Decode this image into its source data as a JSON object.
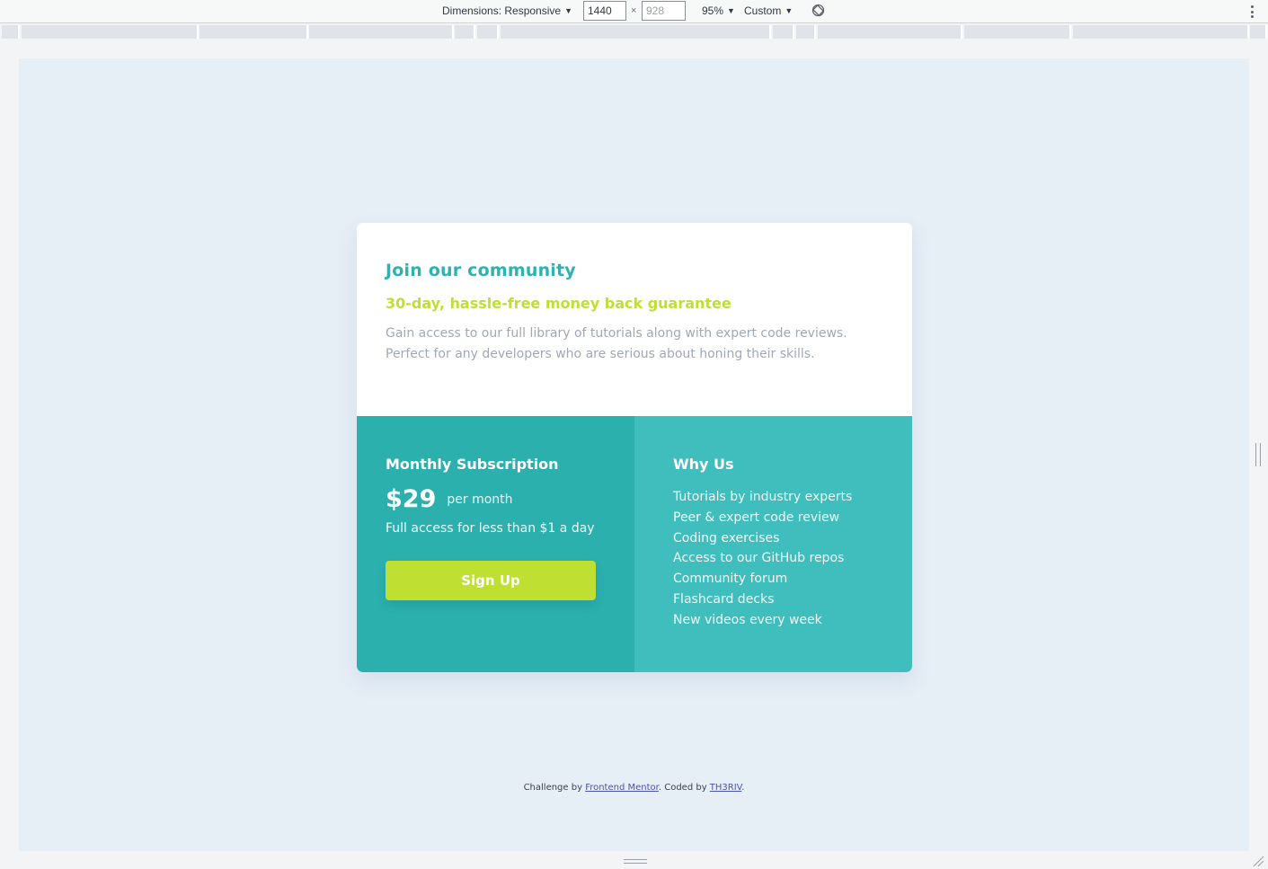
{
  "toolbar": {
    "dimensions_label": "Dimensions: Responsive",
    "width_value": "1440",
    "height_placeholder": "928",
    "times": "×",
    "zoom": "95%",
    "throttle": "Custom"
  },
  "card": {
    "title": "Join our community",
    "subtitle": "30-day, hassle-free money back guarantee",
    "description": "Gain access to our full library of tutorials along with expert code reviews. Perfect for any developers who are serious about honing their skills.",
    "subscription": {
      "heading": "Monthly Subscription",
      "price": "$29",
      "period": "per month",
      "note": "Full access for less than $1 a day",
      "button": "Sign Up"
    },
    "why_us": {
      "heading": "Why Us",
      "items": [
        "Tutorials by industry experts",
        "Peer & expert code review",
        "Coding exercises",
        "Access to our GitHub repos",
        "Community forum",
        "Flashcard decks",
        "New videos every week"
      ]
    }
  },
  "footer": {
    "prefix": "Challenge by ",
    "link1": "Frontend Mentor",
    "middle": ". Coded by ",
    "link2": "TH3RIV",
    "suffix": "."
  },
  "colors": {
    "heading_cyan": "#2bb3b1",
    "lime": "#bfdf33",
    "subscription_bg": "#2bb0ae",
    "why_bg": "#40bebd",
    "page_bg": "#e6eef6"
  }
}
